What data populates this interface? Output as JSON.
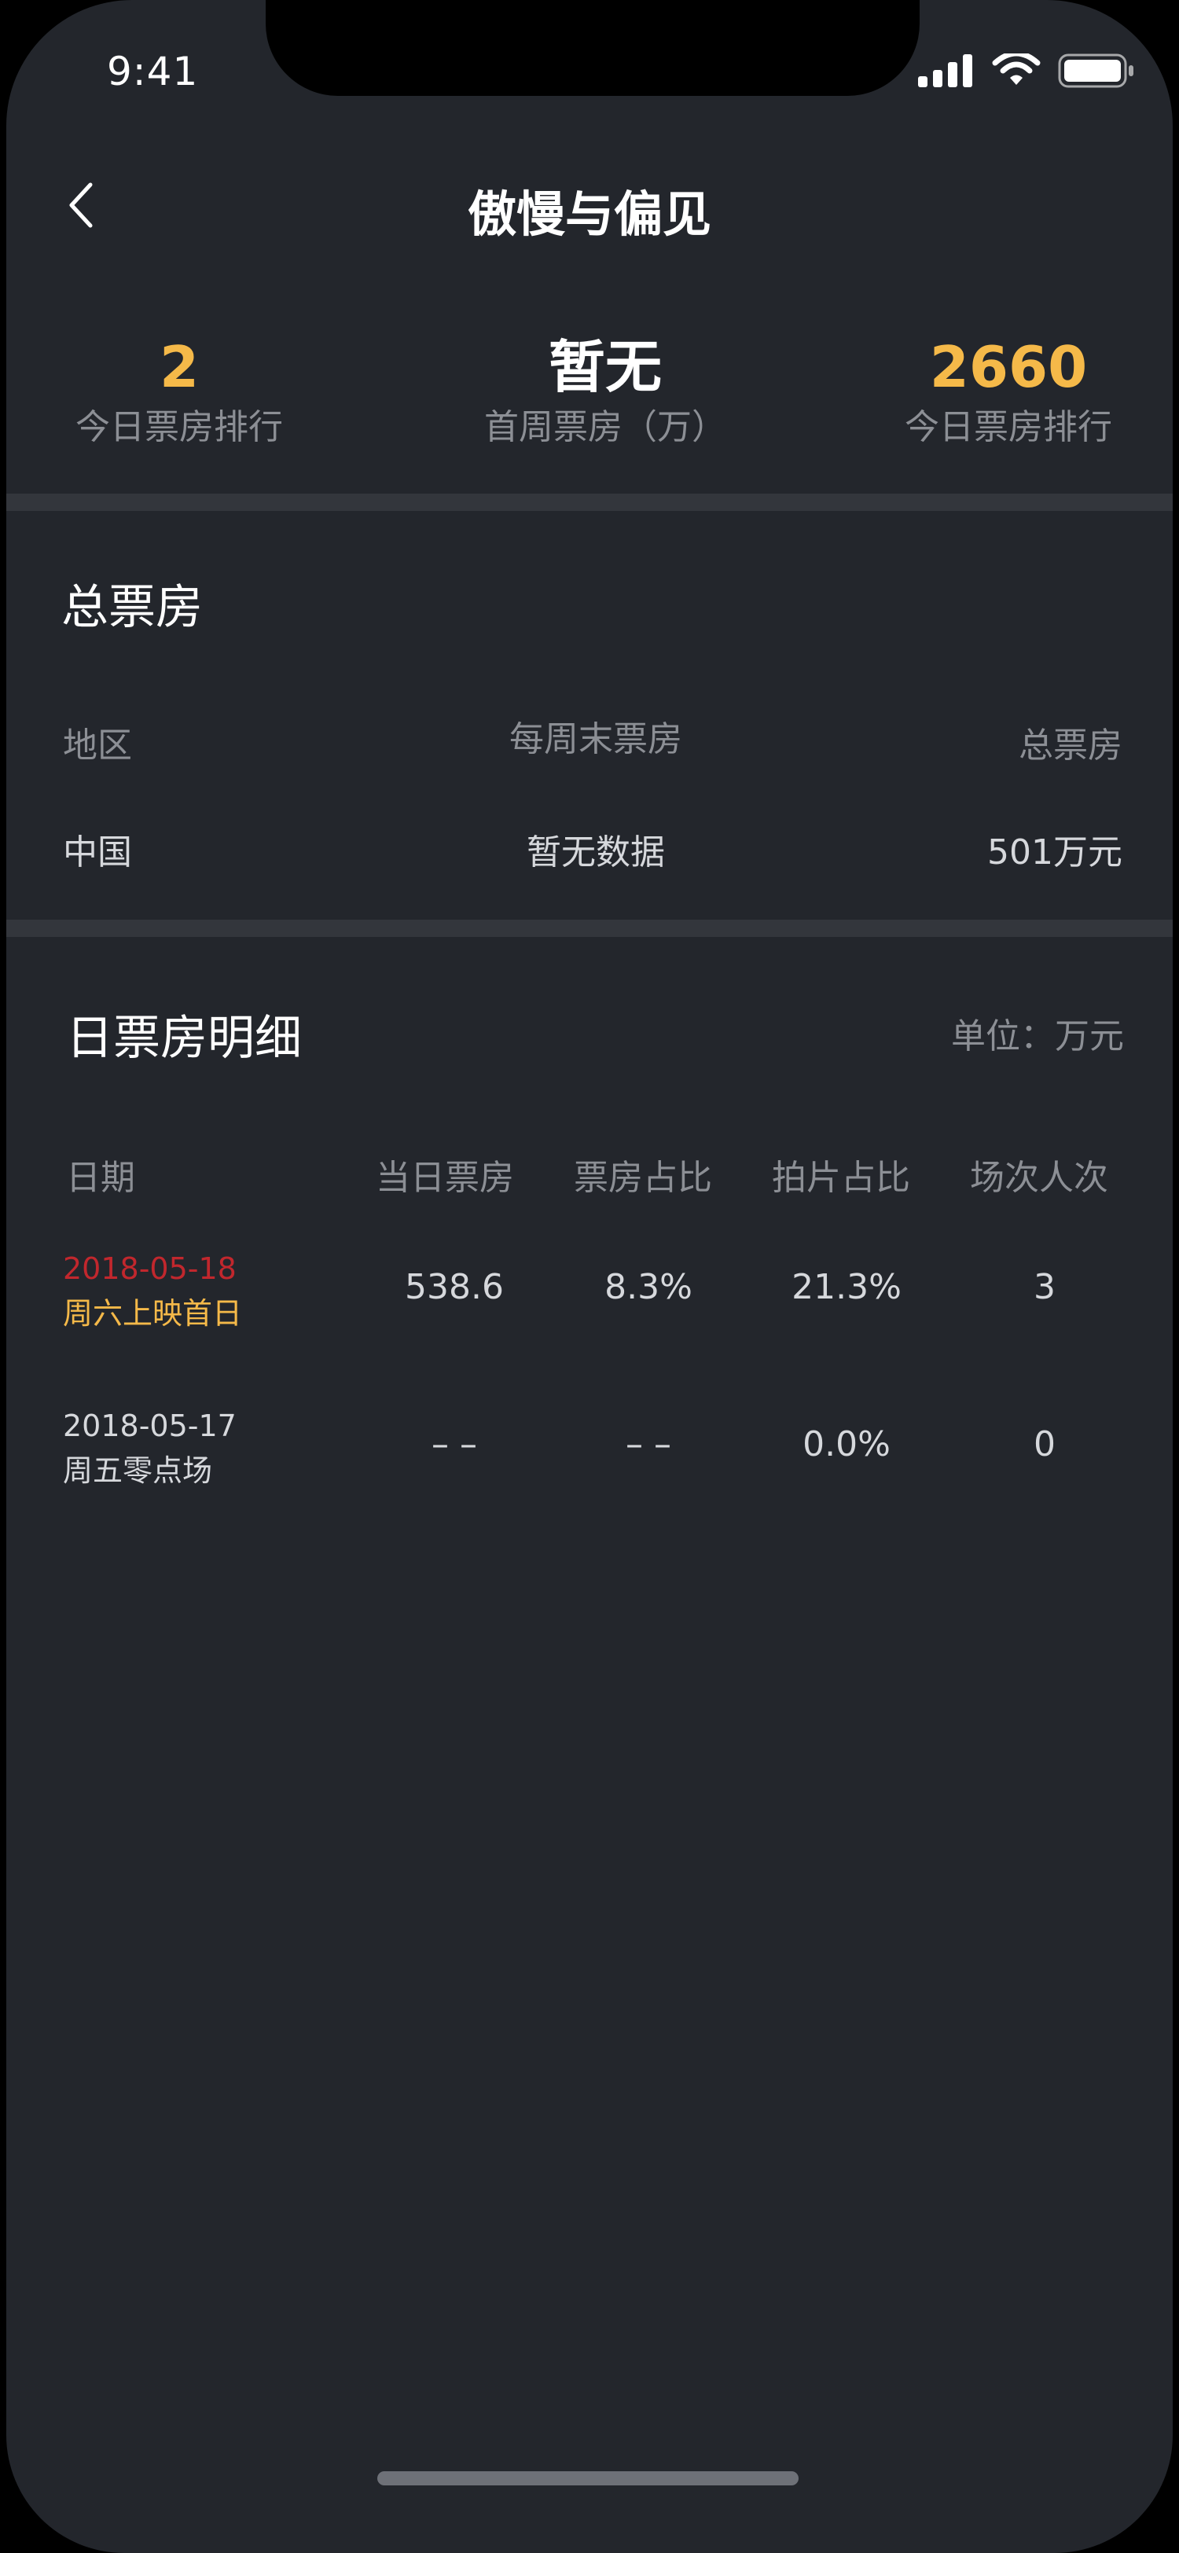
{
  "status_bar": {
    "time": "9:41",
    "icons": [
      "cellular-signal-icon",
      "wifi-icon",
      "battery-icon"
    ]
  },
  "nav": {
    "back_icon": "chevron-left-icon",
    "title": "傲慢与偏见"
  },
  "summary": {
    "items": [
      {
        "value": "2",
        "label": "今日票房排行",
        "color": "#f5b949"
      },
      {
        "value": "暂无",
        "label": "首周票房（万）",
        "color": "#ffffff"
      },
      {
        "value": "2660",
        "label": "今日票房排行",
        "color": "#f5b949"
      }
    ]
  },
  "total_box_office": {
    "title": "总票房",
    "headers": [
      "地区",
      "每周末票房",
      "总票房"
    ],
    "rows": [
      {
        "region": "中国",
        "weekend": "暂无数据",
        "total": "501万元"
      }
    ]
  },
  "daily_detail": {
    "title": "日票房明细",
    "unit": "单位：万元",
    "headers": [
      "日期",
      "当日票房",
      "票房占比",
      "拍片占比",
      "场次人次"
    ],
    "rows": [
      {
        "date": "2018-05-18",
        "note": "周六上映首日",
        "date_color": "#c1272d",
        "note_color": "#f5b949",
        "box_office": "538.6",
        "box_share": "8.3%",
        "screening_share": "21.3%",
        "sessions": "3"
      },
      {
        "date": "2018-05-17",
        "note": "周五零点场",
        "date_color": "#d6d8dc",
        "note_color": "#d6d8dc",
        "box_office": "– –",
        "box_share": "– –",
        "screening_share": "0.0%",
        "sessions": "0"
      }
    ]
  }
}
